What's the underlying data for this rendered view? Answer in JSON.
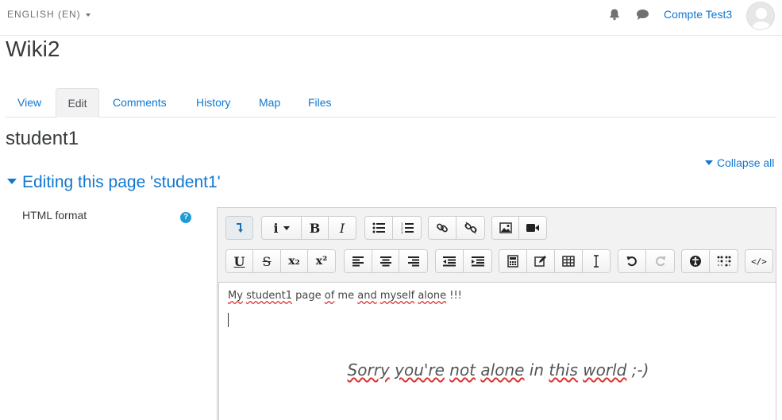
{
  "header": {
    "language": "ENGLISH (EN)",
    "user_name": "Compte Test3",
    "icons": [
      "bell-icon",
      "chat-icon",
      "avatar"
    ]
  },
  "page": {
    "title": "Wiki2",
    "tabs": [
      {
        "label": "View"
      },
      {
        "label": "Edit",
        "active": true
      },
      {
        "label": "Comments"
      },
      {
        "label": "History"
      },
      {
        "label": "Map"
      },
      {
        "label": "Files"
      }
    ],
    "section_title": "student1",
    "collapse_all": "Collapse all",
    "legend": "Editing this page 'student1'",
    "field_label": "HTML format",
    "help_icon": "?"
  },
  "editor": {
    "toolbar_row1": [
      "show-more",
      "info-style",
      "bold",
      "italic",
      "unordered-list",
      "ordered-list",
      "link",
      "unlink",
      "image",
      "media"
    ],
    "toolbar_row2": [
      "underline",
      "strikethrough",
      "subscript",
      "superscript",
      "align-left",
      "align-center",
      "align-right",
      "outdent",
      "indent",
      "equation",
      "character-map",
      "table",
      "clear-formatting",
      "undo",
      "redo",
      "accessibility-checker",
      "screen-reader-helper",
      "html"
    ],
    "labels": {
      "info": "i",
      "bold": "B",
      "italic": "I",
      "underline": "U",
      "strike": "S",
      "sub": "x₂",
      "sup": "x²",
      "html": "</>"
    },
    "content": {
      "line1_parts": [
        "My",
        " ",
        "student1",
        " page ",
        "of",
        " me ",
        "and",
        " ",
        "myself",
        " ",
        "alone",
        " !!!"
      ],
      "line2_parts": [
        "Sorry",
        " ",
        "you're",
        " ",
        "not",
        " ",
        "alone",
        " in ",
        "this",
        " ",
        "world",
        " ;-)"
      ]
    }
  }
}
